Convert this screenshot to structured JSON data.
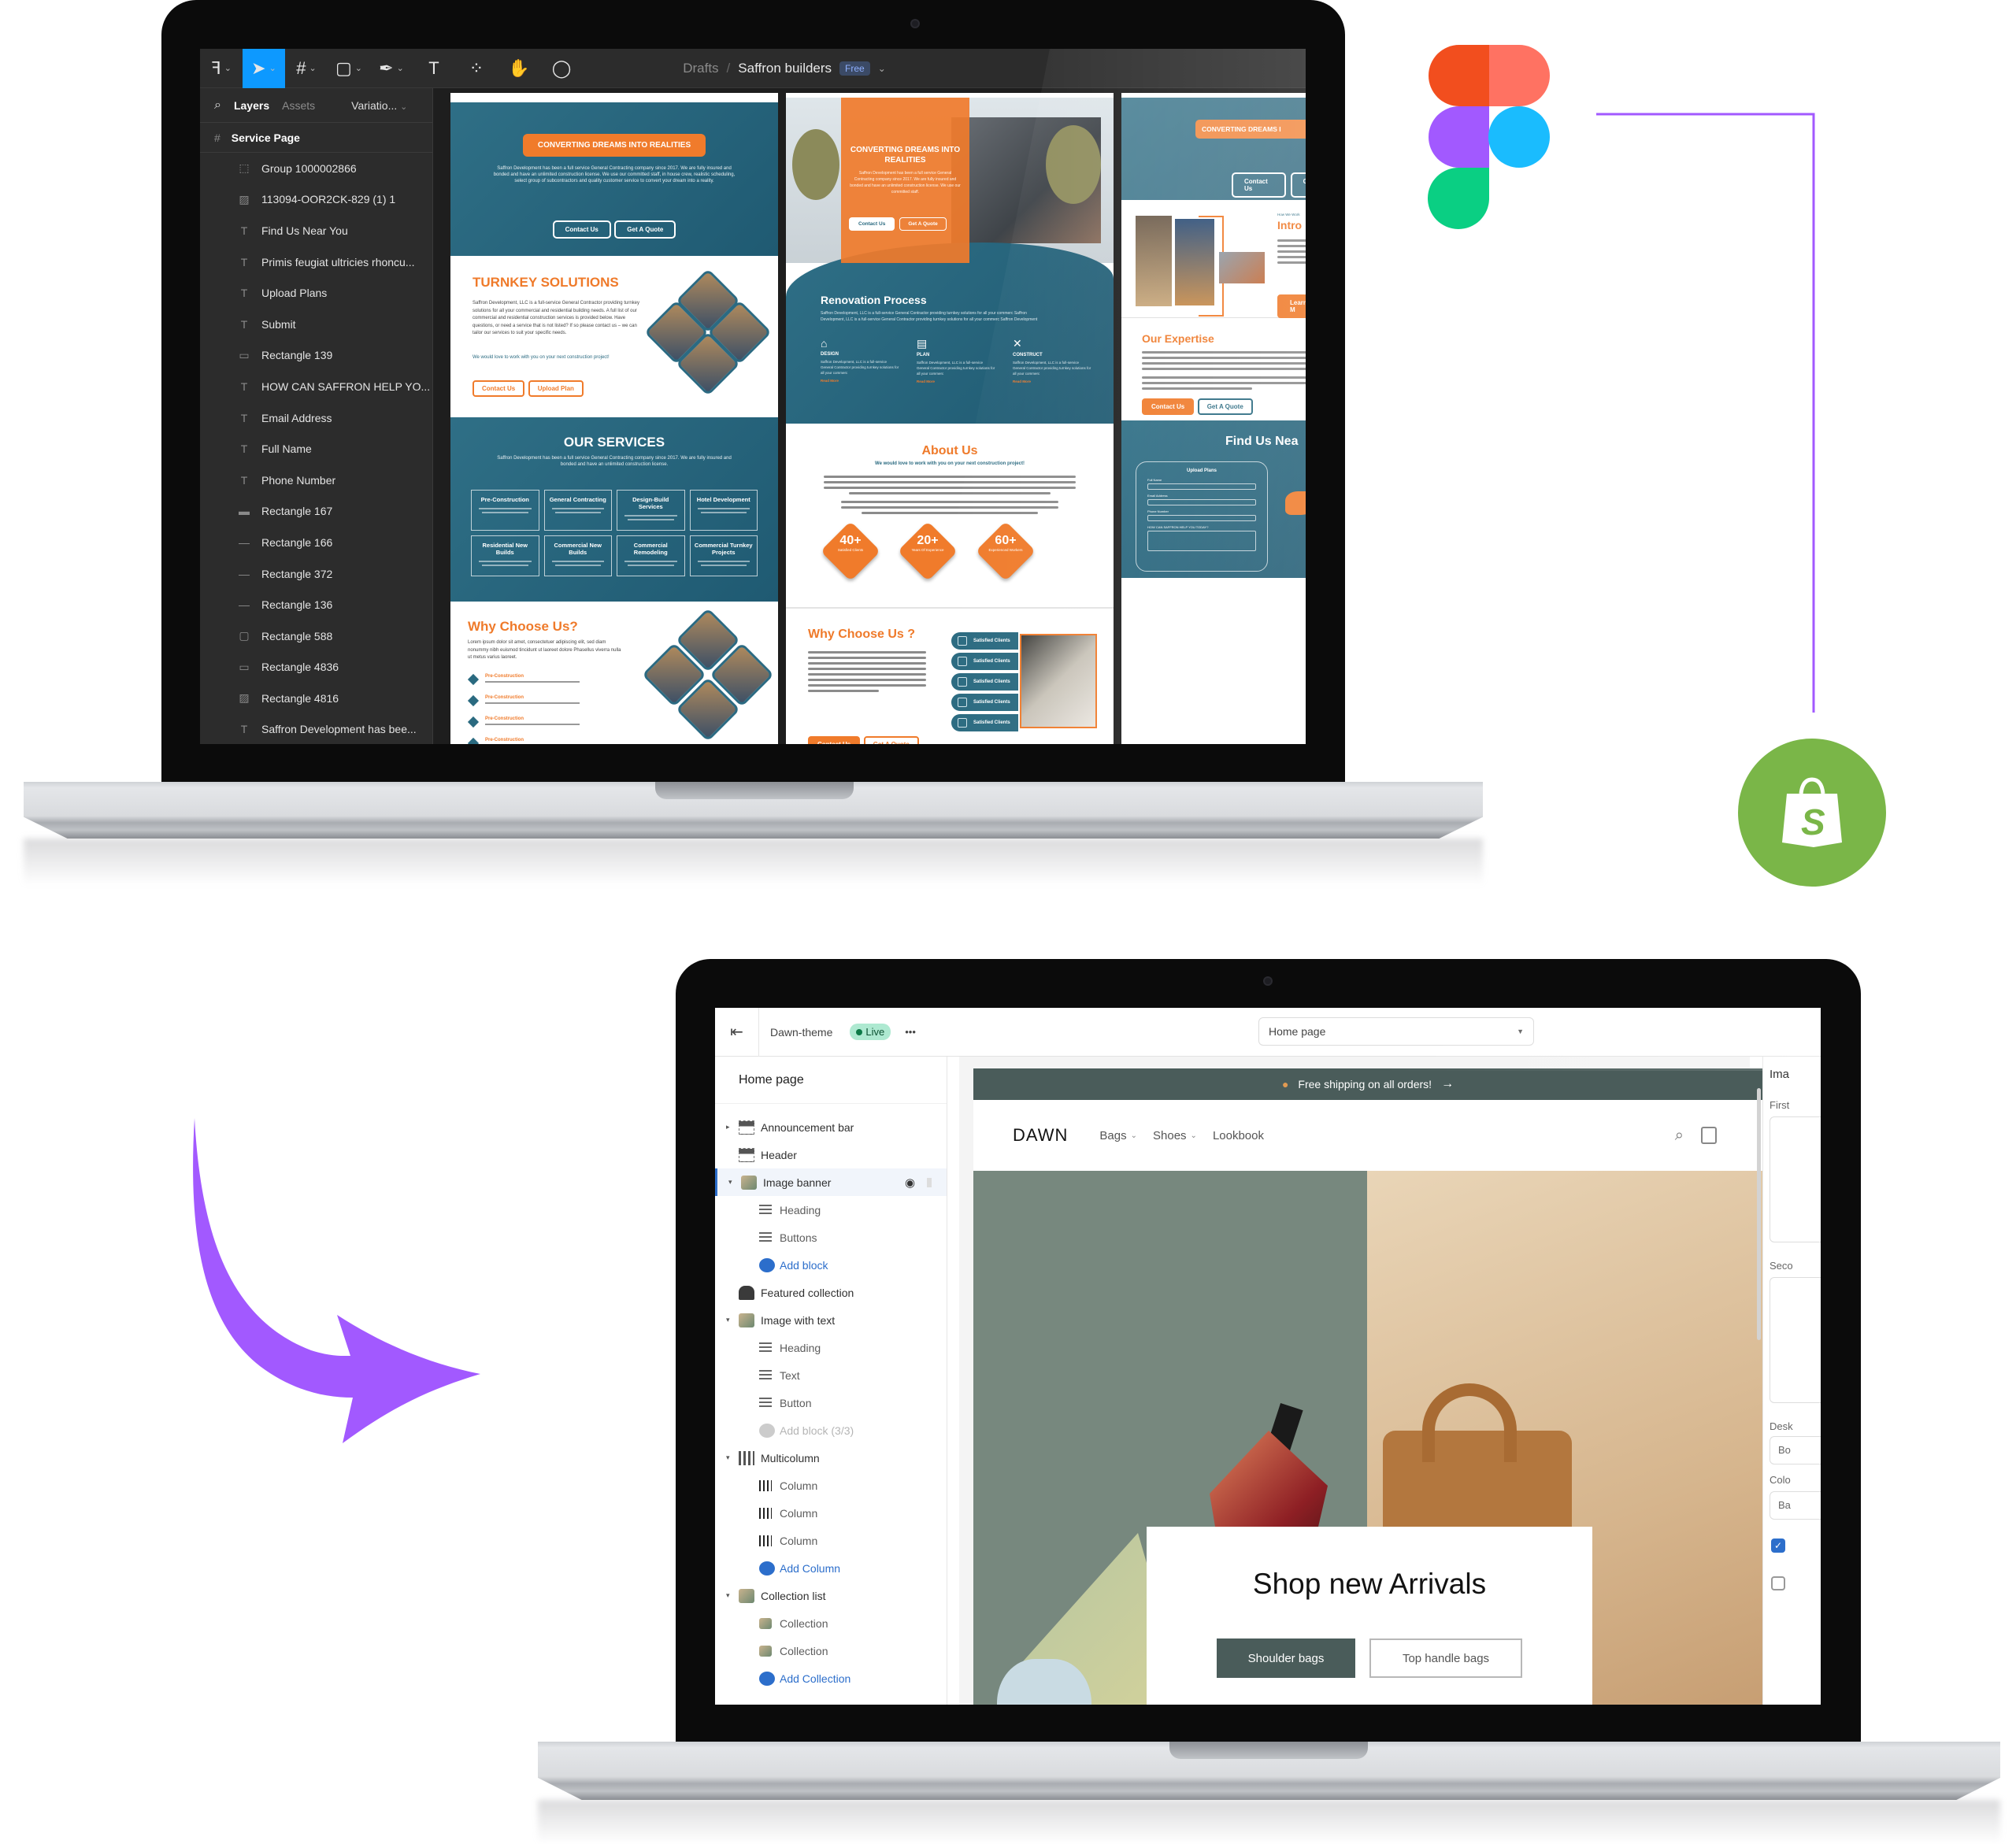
{
  "colors": {
    "figma_toolbar_active": "#0d99ff",
    "brand_orange": "#f07b2b",
    "brand_teal": "#2a6a80",
    "connector_purple": "#a259ff",
    "shopify_green": "#7ab648",
    "dawn_dark": "#4a5c5a"
  },
  "figma": {
    "toolbar": {
      "tools": [
        {
          "icon": "main-menu-icon",
          "glyph": "ꟻ"
        },
        {
          "icon": "move-tool-icon",
          "glyph": "➤"
        },
        {
          "icon": "frame-tool-icon",
          "glyph": "#"
        },
        {
          "icon": "shape-tool-icon",
          "glyph": "▢"
        },
        {
          "icon": "pen-tool-icon",
          "glyph": "✒"
        },
        {
          "icon": "text-tool-icon",
          "glyph": "T"
        },
        {
          "icon": "components-icon",
          "glyph": "⁘"
        },
        {
          "icon": "hand-tool-icon",
          "glyph": "✋"
        },
        {
          "icon": "comment-icon",
          "glyph": "◯"
        }
      ],
      "breadcrumb_root": "Drafts",
      "separator": "/",
      "file_name": "Saffron builders",
      "plan_badge": "Free"
    },
    "left_panel": {
      "tabs": [
        "Layers",
        "Assets"
      ],
      "variations": "Variatio...",
      "page": "Service Page",
      "layers": [
        {
          "icon": "group",
          "glyph": "⬚",
          "name": "Group 1000002866"
        },
        {
          "icon": "image",
          "glyph": "▨",
          "name": "113094-OOR2CK-829 (1) 1"
        },
        {
          "icon": "text",
          "glyph": "T",
          "name": "Find Us Near You"
        },
        {
          "icon": "text",
          "glyph": "T",
          "name": "Primis feugiat ultricies rhoncu..."
        },
        {
          "icon": "text",
          "glyph": "T",
          "name": "Upload Plans"
        },
        {
          "icon": "text",
          "glyph": "T",
          "name": "Submit"
        },
        {
          "icon": "rectangle",
          "glyph": "▭",
          "name": "Rectangle 139"
        },
        {
          "icon": "text",
          "glyph": "T",
          "name": "HOW CAN SAFFRON HELP YO..."
        },
        {
          "icon": "text",
          "glyph": "T",
          "name": "Email Address"
        },
        {
          "icon": "text",
          "glyph": "T",
          "name": "Full Name"
        },
        {
          "icon": "text",
          "glyph": "T",
          "name": "Phone Number"
        },
        {
          "icon": "rectangle",
          "glyph": "▬",
          "name": "Rectangle 167"
        },
        {
          "icon": "line",
          "glyph": "—",
          "name": "Rectangle 166"
        },
        {
          "icon": "line",
          "glyph": "—",
          "name": "Rectangle 372"
        },
        {
          "icon": "line",
          "glyph": "—",
          "name": "Rectangle 136"
        },
        {
          "icon": "rectangle",
          "glyph": "▢",
          "name": "Rectangle 588"
        },
        {
          "icon": "rectangle",
          "glyph": "▭",
          "name": "Rectangle 4836"
        },
        {
          "icon": "image",
          "glyph": "▨",
          "name": "Rectangle 4816"
        },
        {
          "icon": "text",
          "glyph": "T",
          "name": "Saffron Development has bee..."
        }
      ]
    },
    "frames": {
      "frame1": {
        "hero_badge": "CONVERTING DREAMS INTO REALITIES",
        "hero_text": "Saffron Development has been a full service General Contracting company since 2017. We are fully insured and bonded and have an unlimited construction license. We use our committed staff, in house crew, realistic scheduling, select group of subcontractors and quality customer service to convert your dream into a reality.",
        "hero_buttons": [
          "Contact Us",
          "Get A Quote"
        ],
        "turnkey_title": "TURNKEY SOLUTIONS",
        "turnkey_text": "Saffron Development, LLC is a full-service General Contractor providing turnkey solutions for all your commercial and residential building needs. A full list of our commercial and residential construction services is provided below. Have questions, or need a service that is not listed? If so please contact us – we can tailor our services to suit your specific needs.",
        "turnkey_cta": "We would love to work with you on your next construction project!",
        "turnkey_buttons": [
          "Contact Us",
          "Upload Plan"
        ],
        "services_title": "OUR SERVICES",
        "services_text": "Saffron Development has been a full service General Contracting company since 2017. We are fully insured and bonded and have an unlimited construction license.",
        "services": [
          "Pre-Construction",
          "General Contracting",
          "Design-Build Services",
          "Hotel Development",
          "Residential New Builds",
          "Commercial New Builds",
          "Commercial Remodeling",
          "Commercial Turnkey Projects"
        ],
        "why_title": "Why Choose Us?",
        "why_text": "Lorem ipsum dolor sit amet, consectetuer adipiscing elit, sed diam nonummy nibh euismod tincidunt ut laoreet dolore Phasellus viverra nulla ut metus varius laoreet.",
        "why_steps": [
          "Pre-Construction",
          "Pre-Construction",
          "Pre-Construction",
          "Pre-Construction"
        ]
      },
      "frame2": {
        "hero_title": "CONVERTING DREAMS INTO REALITIES",
        "hero_text": "Saffron Development has been a full service General Contracting company since 2017. We are fully insured and bonded and have an unlimited construction license. We use our committed staff.",
        "hero_buttons": [
          "Contact Us",
          "Get A Quote"
        ],
        "process_title": "Renovation Process",
        "process_text": "Saffron Development, LLC is a full-service General Contractor providing turnkey solutions for all your commerc Saffron Development, LLC is a full-service General Contractor providing turnkey solutions for all your commerc Saffron Development",
        "steps": [
          {
            "icon": "house-icon",
            "glyph": "⌂",
            "title": "DESIGN",
            "link": "Read More"
          },
          {
            "icon": "blueprint-icon",
            "glyph": "▤",
            "title": "PLAN",
            "link": "Read More"
          },
          {
            "icon": "tools-icon",
            "glyph": "✕",
            "title": "CONSTRUCT",
            "link": "Read More"
          }
        ],
        "step_text": "Saffron Development, LLC is a full-service General Contractor providing turnkey solutions for all your commerc",
        "about_title": "About Us",
        "about_subtitle": "We would love to work with you on your next construction project!",
        "stats": [
          {
            "value": "40+",
            "label": "Satisfied Clients"
          },
          {
            "value": "20+",
            "label": "Years Of Experience"
          },
          {
            "value": "60+",
            "label": "Experienced Workers"
          }
        ],
        "why_title": "Why Choose Us ?",
        "why_pills": [
          "Satisfied Clients",
          "Satisfied Clients",
          "Satisfied Clients",
          "Satisfied Clients",
          "Satisfied Clients"
        ],
        "why_buttons": [
          "Contact Us",
          "Get A Quote"
        ]
      },
      "frame3": {
        "hero_badge": "CONVERTING DREAMS I",
        "hero_buttons": [
          "Contact Us",
          "Get"
        ],
        "intro_kicker": "How We Work",
        "intro_title": "Intro",
        "intro_button": "Learn M",
        "expertise_title": "Our Expertise",
        "expertise_buttons": [
          "Contact Us",
          "Get A Quote"
        ],
        "find_title": "Find Us Nea",
        "form_title": "Upload Plans",
        "form_fields": [
          "Full Name",
          "Email Address",
          "Phone Number",
          "HOW CAN SAFFRON HELP YOU TODAY?"
        ]
      }
    }
  },
  "connector": {
    "from": "figma-logo",
    "to": "shopify-logo"
  },
  "shopify": {
    "topbar": {
      "theme_name": "Dawn-theme",
      "status_badge": "Live",
      "more": "•••",
      "page_select": "Home page"
    },
    "sidebar": {
      "title": "Home page",
      "sections": [
        {
          "level": 0,
          "toggle": "▸",
          "label": "Announcement bar",
          "icon": "layout-icon"
        },
        {
          "level": 0,
          "toggle": "",
          "label": "Header",
          "icon": "layout-icon"
        },
        {
          "level": 0,
          "toggle": "▾",
          "label": "Image banner",
          "icon": "image-icon",
          "selected": true
        },
        {
          "level": 1,
          "label": "Heading",
          "icon": "text-block-icon"
        },
        {
          "level": 1,
          "label": "Buttons",
          "icon": "text-block-icon"
        },
        {
          "level": 1,
          "label": "Add block",
          "icon": "add-icon",
          "type": "add"
        },
        {
          "level": 0,
          "toggle": "",
          "label": "Featured collection",
          "icon": "tag-icon"
        },
        {
          "level": 0,
          "toggle": "▾",
          "label": "Image with text",
          "icon": "image-icon"
        },
        {
          "level": 1,
          "label": "Heading",
          "icon": "text-block-icon"
        },
        {
          "level": 1,
          "label": "Text",
          "icon": "text-block-icon"
        },
        {
          "level": 1,
          "label": "Button",
          "icon": "text-block-icon"
        },
        {
          "level": 1,
          "label": "Add block (3/3)",
          "icon": "add-icon",
          "type": "disabled"
        },
        {
          "level": 0,
          "toggle": "▾",
          "label": "Multicolumn",
          "icon": "columns-icon"
        },
        {
          "level": 1,
          "label": "Column",
          "icon": "column-icon"
        },
        {
          "level": 1,
          "label": "Column",
          "icon": "column-icon"
        },
        {
          "level": 1,
          "label": "Column",
          "icon": "column-icon"
        },
        {
          "level": 1,
          "label": "Add Column",
          "icon": "add-icon",
          "type": "add"
        },
        {
          "level": 0,
          "toggle": "▾",
          "label": "Collection list",
          "icon": "image-icon"
        },
        {
          "level": 1,
          "label": "Collection",
          "icon": "image-icon"
        },
        {
          "level": 1,
          "label": "Collection",
          "icon": "image-icon"
        },
        {
          "level": 1,
          "label": "Add Collection",
          "icon": "add-icon",
          "type": "add"
        }
      ]
    },
    "preview": {
      "announcement": "Free shipping on all orders!",
      "announcement_arrow": "→",
      "logo": "DAWN",
      "nav": [
        {
          "label": "Bags",
          "dropdown": true
        },
        {
          "label": "Shoes",
          "dropdown": true
        },
        {
          "label": "Lookbook",
          "dropdown": false
        }
      ],
      "banner_heading": "Shop new Arrivals",
      "banner_buttons": [
        "Shoulder bags",
        "Top handle bags"
      ]
    },
    "settings_panel": {
      "title": "Ima",
      "labels": [
        "First",
        "Seco",
        "Desk",
        "Colo"
      ],
      "select_values": [
        "Bo",
        "Ba"
      ],
      "checkboxes": [
        true,
        false
      ]
    }
  }
}
